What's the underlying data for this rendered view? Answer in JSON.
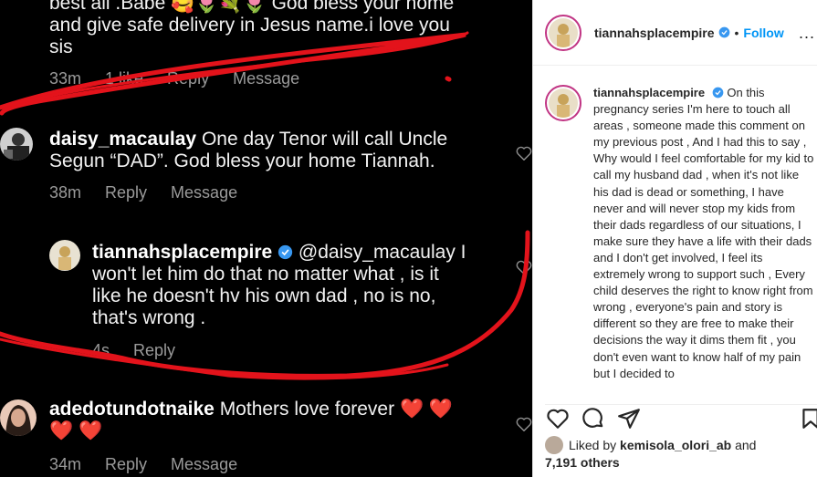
{
  "left": {
    "top_comment": {
      "line1": "best ali .Babe",
      "line1_tail": "God bless your home",
      "line2": "and give safe delivery in Jesus name.i love you",
      "line3": "sis",
      "time": "33m",
      "likes": "1 like",
      "reply": "Reply",
      "message": "Message"
    },
    "comment1": {
      "user": "daisy_macaulay",
      "text_l1": "One day Tenor will call Uncle",
      "text_l2": "Segun “DAD”. God bless your home Tiannah.",
      "time": "38m",
      "reply": "Reply",
      "message": "Message"
    },
    "reply1": {
      "user": "tiannahsplacempire",
      "mention": "@daisy_macaulay I",
      "l2": "won't let him do that no matter what , is it",
      "l3": "like he doesn't hv his own dad , no is no,",
      "l4": "that's wrong .",
      "time": "4s",
      "reply": "Reply"
    },
    "comment2": {
      "user": "adedotundotnaike",
      "text": "Mothers love forever",
      "hearts": "❤️ ❤️",
      "hearts2": "❤️ ❤️",
      "time": "34m",
      "reply": "Reply",
      "message": "Message"
    },
    "colors": {
      "highlight": "#e3131b",
      "heart": "#e0242e"
    }
  },
  "post": {
    "handle": "tiannahsplacempire",
    "dot": "•",
    "follow": "Follow",
    "more": "...",
    "caption_user": "tiannahsplacempire",
    "caption_text": "On this pregnancy series I'm here to touch all areas , someone made this comment on my previous post , And I had this to say , Why would I feel comfortable for my kid to call my husband dad , when it's not like his dad is dead or something, I have never and will never stop my kids from their dads regardless of our situations, I make sure they have a life with their dads and I don't get involved, I feel its extremely wrong to support such , Every child deserves the right to know right from wrong , everyone's pain and story is different so they are free to make their decisions the way it dims them fit , you don't even want to know half of my pain but I decided to",
    "liked_by_prefix": "Liked by",
    "liked_by_user": "kemisola_olori_ab",
    "and": "and",
    "others": "7,191 others",
    "icons": [
      "heart-icon",
      "comment-icon",
      "share-icon",
      "bookmark-icon"
    ]
  }
}
